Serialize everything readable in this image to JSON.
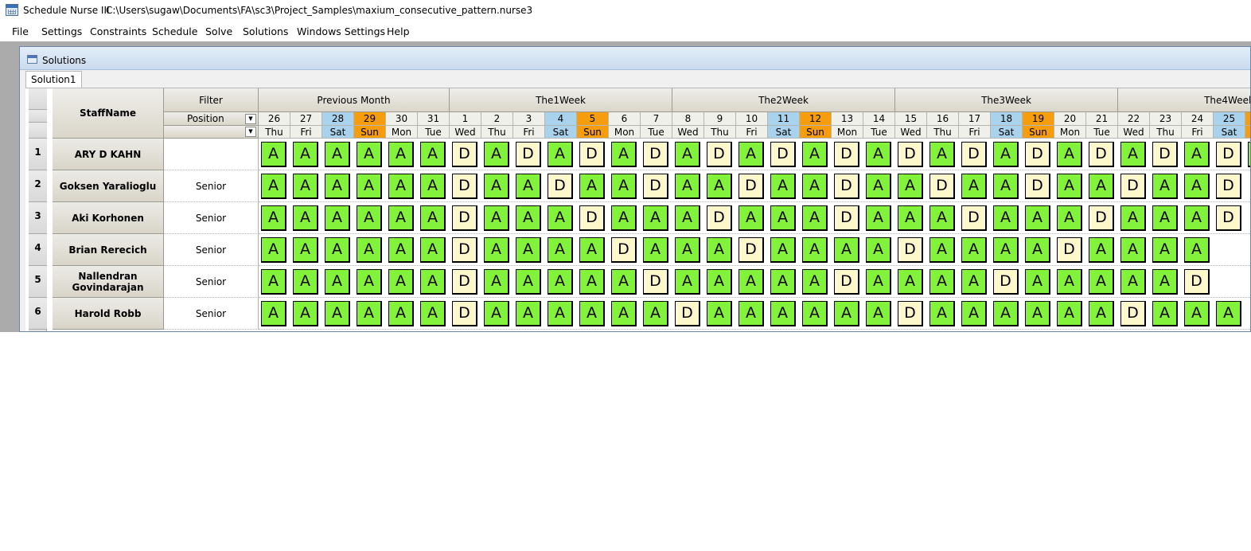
{
  "window": {
    "title": "Schedule Nurse III",
    "path": "C:\\Users\\sugaw\\Documents\\FA\\sc3\\Project_Samples\\maxium_consecutive_pattern.nurse3"
  },
  "menu": [
    "File",
    "Settings",
    "Constraints",
    "Schedule",
    "Solve",
    "Solutions",
    "Windows Settings",
    "Help"
  ],
  "child_window": {
    "title": "Solutions",
    "tab": "Solution1"
  },
  "grid": {
    "staff_header": "StaffName",
    "filter_header": "Filter",
    "position_header": "Position",
    "week_groups": [
      "Previous Month",
      "The1Week",
      "The2Week",
      "The3Week",
      "The4Week"
    ],
    "days": [
      {
        "d": "26",
        "w": "Thu",
        "k": ""
      },
      {
        "d": "27",
        "w": "Fri",
        "k": ""
      },
      {
        "d": "28",
        "w": "Sat",
        "k": "sat"
      },
      {
        "d": "29",
        "w": "Sun",
        "k": "sun"
      },
      {
        "d": "30",
        "w": "Mon",
        "k": ""
      },
      {
        "d": "31",
        "w": "Tue",
        "k": ""
      },
      {
        "d": "1",
        "w": "Wed",
        "k": ""
      },
      {
        "d": "2",
        "w": "Thu",
        "k": ""
      },
      {
        "d": "3",
        "w": "Fri",
        "k": ""
      },
      {
        "d": "4",
        "w": "Sat",
        "k": "sat"
      },
      {
        "d": "5",
        "w": "Sun",
        "k": "sun"
      },
      {
        "d": "6",
        "w": "Mon",
        "k": ""
      },
      {
        "d": "7",
        "w": "Tue",
        "k": ""
      },
      {
        "d": "8",
        "w": "Wed",
        "k": ""
      },
      {
        "d": "9",
        "w": "Thu",
        "k": ""
      },
      {
        "d": "10",
        "w": "Fri",
        "k": ""
      },
      {
        "d": "11",
        "w": "Sat",
        "k": "sat"
      },
      {
        "d": "12",
        "w": "Sun",
        "k": "sun"
      },
      {
        "d": "13",
        "w": "Mon",
        "k": ""
      },
      {
        "d": "14",
        "w": "Tue",
        "k": ""
      },
      {
        "d": "15",
        "w": "Wed",
        "k": ""
      },
      {
        "d": "16",
        "w": "Thu",
        "k": ""
      },
      {
        "d": "17",
        "w": "Fri",
        "k": ""
      },
      {
        "d": "18",
        "w": "Sat",
        "k": "sat"
      },
      {
        "d": "19",
        "w": "Sun",
        "k": "sun"
      },
      {
        "d": "20",
        "w": "Mon",
        "k": ""
      },
      {
        "d": "21",
        "w": "Tue",
        "k": ""
      },
      {
        "d": "22",
        "w": "Wed",
        "k": ""
      },
      {
        "d": "23",
        "w": "Thu",
        "k": ""
      },
      {
        "d": "24",
        "w": "Fri",
        "k": ""
      },
      {
        "d": "25",
        "w": "Sat",
        "k": "sat"
      },
      {
        "d": "",
        "w": "",
        "k": "sun"
      }
    ],
    "rows": [
      {
        "num": "1",
        "name": "ARY D KAHN",
        "position": "",
        "shifts": "AAAAAADADADADADADADADADADADADADA"
      },
      {
        "num": "2",
        "name": "Goksen Yaralioglu",
        "position": "Senior",
        "shifts": "AAAAAADAADAADAADAADAADAADAADAAD"
      },
      {
        "num": "3",
        "name": "Aki Korhonen",
        "position": "Senior",
        "shifts": "AAAAAADAAADAAADAAADAAADAAADAAAD"
      },
      {
        "num": "4",
        "name": "Brian Rerecich",
        "position": "Senior",
        "shifts": "AAAAAADAAAADAAADAAAADAAAADAAAA"
      },
      {
        "num": "5",
        "name": "Nallendran Govindarajan",
        "position": "Senior",
        "shifts": "AAAAAADAAAAADAAAAADAAAADAAAAAD"
      },
      {
        "num": "6",
        "name": "Harold Robb",
        "position": "Senior",
        "shifts": "AAAAAADAAAAAADAAAAAADAAAAAADAAA"
      }
    ]
  },
  "colors": {
    "shift_A": "#82f23a",
    "shift_D": "#fdf8cb",
    "saturday": "#a9d2ec",
    "sunday": "#f59d0c"
  }
}
